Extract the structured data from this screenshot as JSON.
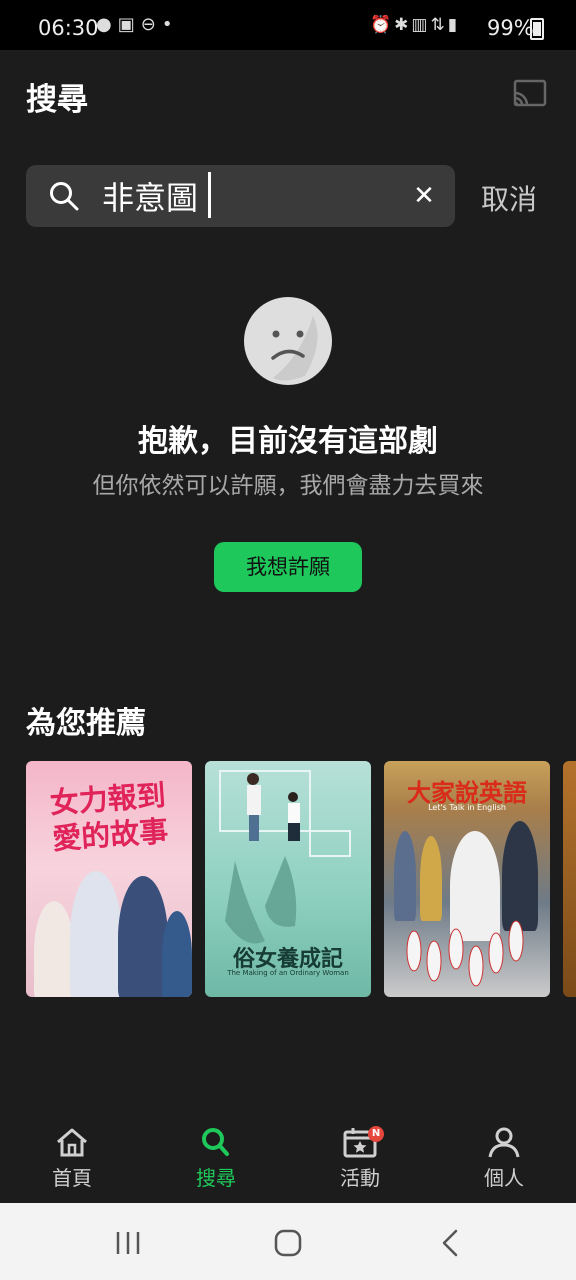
{
  "status_bar": {
    "time": "06:30",
    "left_icons": [
      "chat-bubble-icon",
      "iqiyi-icon",
      "do-not-disturb-icon",
      "dot-icon"
    ],
    "right_icons": [
      "alarm-icon",
      "bluetooth-icon",
      "volte-lte-icon",
      "4g-data-icon",
      "signal-icon"
    ],
    "battery": "99%"
  },
  "header": {
    "title": "搜尋",
    "cast_icon": "cast-icon"
  },
  "search": {
    "value": "非意圖",
    "clear_label": "✕",
    "cancel_label": "取消"
  },
  "empty_state": {
    "icon": "sad-face-icon",
    "title": "抱歉，目前沒有這部劇",
    "subtitle": "但你依然可以許願，我們會盡力去買來",
    "button_label": "我想許願"
  },
  "recommend": {
    "title": "為您推薦",
    "posters": [
      {
        "title": "女力報到 愛的故事"
      },
      {
        "title": "俗女養成記",
        "subtitle": "The Making of an Ordinary Woman"
      },
      {
        "title": "大家說英語",
        "subtitle": "Let's Talk in English"
      }
    ]
  },
  "bottom_nav": {
    "items": [
      {
        "label": "首頁",
        "icon": "home-icon"
      },
      {
        "label": "搜尋",
        "icon": "search-icon",
        "active": true
      },
      {
        "label": "活動",
        "icon": "calendar-star-icon",
        "badge": "N"
      },
      {
        "label": "個人",
        "icon": "person-icon"
      }
    ]
  },
  "colors": {
    "accent": "#1ec85a",
    "background": "#1c1c1c",
    "search_bg": "#3a3a3a"
  }
}
